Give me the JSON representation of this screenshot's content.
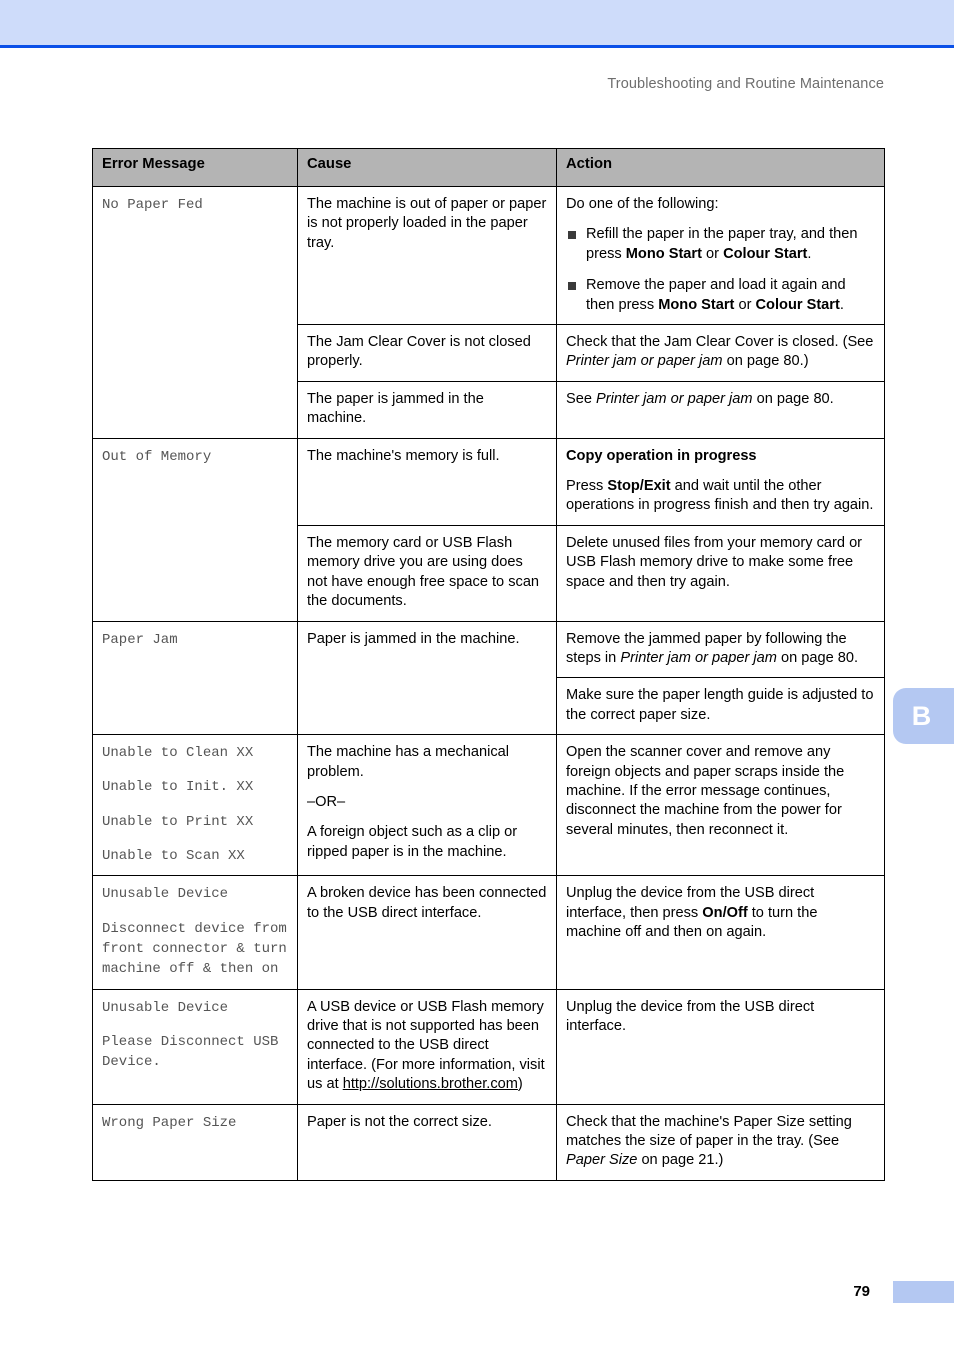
{
  "page": {
    "running_header": "Troubleshooting and Routine Maintenance",
    "page_number": "79",
    "chapter_tab_letter": "B",
    "accent_band_color": "#cedcfa",
    "accent_rule_color": "#0a50e8",
    "tab_color": "#b4c8f2",
    "header_row_color": "#b4b4b4"
  },
  "table": {
    "columns": [
      "Error Message",
      "Cause",
      "Action"
    ],
    "rows": [
      {
        "error_lines": [
          "No Paper Fed"
        ],
        "cells": [
          {
            "cause": {
              "paragraphs": [
                "The machine is out of paper or paper is not properly loaded in the paper tray."
              ]
            },
            "action": {
              "lead": "Do one of the following:",
              "bullets": [
                {
                  "parts": [
                    {
                      "t": "Refill the paper in the paper tray, and then press ",
                      "s": "normal"
                    },
                    {
                      "t": "Mono Start",
                      "s": "bold"
                    },
                    {
                      "t": " or ",
                      "s": "normal"
                    },
                    {
                      "t": "Colour Start",
                      "s": "bold"
                    },
                    {
                      "t": ".",
                      "s": "normal"
                    }
                  ]
                },
                {
                  "parts": [
                    {
                      "t": "Remove the paper and load it again and then press ",
                      "s": "normal"
                    },
                    {
                      "t": "Mono Start",
                      "s": "bold"
                    },
                    {
                      "t": " or ",
                      "s": "normal"
                    },
                    {
                      "t": "Colour Start",
                      "s": "bold"
                    },
                    {
                      "t": ".",
                      "s": "normal"
                    }
                  ]
                }
              ]
            }
          },
          {
            "cause": {
              "paragraphs": [
                "The Jam Clear Cover is not closed properly."
              ]
            },
            "action": {
              "paragraphs": [
                {
                  "parts": [
                    {
                      "t": "Check that the Jam Clear Cover is closed. (See ",
                      "s": "normal"
                    },
                    {
                      "t": "Printer jam or paper jam",
                      "s": "italic"
                    },
                    {
                      "t": " on page 80.)",
                      "s": "normal"
                    }
                  ]
                }
              ]
            }
          },
          {
            "cause": {
              "paragraphs": [
                "The paper is jammed in the machine."
              ]
            },
            "action": {
              "paragraphs": [
                {
                  "parts": [
                    {
                      "t": "See ",
                      "s": "normal"
                    },
                    {
                      "t": "Printer jam or paper jam",
                      "s": "italic"
                    },
                    {
                      "t": " on page 80.",
                      "s": "normal"
                    }
                  ]
                }
              ]
            }
          }
        ]
      },
      {
        "error_lines": [
          "Out of Memory"
        ],
        "cells": [
          {
            "cause": {
              "paragraphs": [
                "The machine's memory is full."
              ]
            },
            "action": {
              "heading": "Copy operation in progress",
              "paragraphs": [
                {
                  "parts": [
                    {
                      "t": "Press ",
                      "s": "normal"
                    },
                    {
                      "t": "Stop/Exit",
                      "s": "bold"
                    },
                    {
                      "t": " and wait until the other operations in progress finish and then try again.",
                      "s": "normal"
                    }
                  ]
                }
              ]
            }
          },
          {
            "cause": {
              "paragraphs": [
                "The memory card or USB Flash memory drive you are using does not have enough free space to scan the documents."
              ]
            },
            "action": {
              "paragraphs": [
                {
                  "parts": [
                    {
                      "t": "Delete unused files from your memory card or USB Flash memory drive to make some free space and then try again.",
                      "s": "normal"
                    }
                  ]
                }
              ]
            }
          }
        ]
      },
      {
        "error_lines": [
          "Paper Jam"
        ],
        "cells": [
          {
            "cause": {
              "paragraphs": [
                "Paper is jammed in the machine."
              ],
              "rowspan": 2
            },
            "action": {
              "paragraphs": [
                {
                  "parts": [
                    {
                      "t": "Remove the jammed paper by following the steps in ",
                      "s": "normal"
                    },
                    {
                      "t": "Printer jam or paper jam",
                      "s": "italic"
                    },
                    {
                      "t": " on page 80.",
                      "s": "normal"
                    }
                  ]
                }
              ]
            }
          },
          {
            "action": {
              "paragraphs": [
                {
                  "parts": [
                    {
                      "t": "Make sure the paper length guide is adjusted to the correct paper size.",
                      "s": "normal"
                    }
                  ]
                }
              ]
            }
          }
        ]
      },
      {
        "error_lines": [
          "Unable to Clean XX",
          "Unable to Init. XX",
          "Unable to Print XX",
          "Unable to Scan XX"
        ],
        "cells": [
          {
            "cause": {
              "paragraphs": [
                "The machine has a mechanical problem.",
                "–OR–",
                "A foreign object such as a clip or ripped paper is in the machine."
              ]
            },
            "action": {
              "paragraphs": [
                {
                  "parts": [
                    {
                      "t": "Open the scanner cover and remove any foreign objects and paper scraps inside the machine. If the error message continues, disconnect the machine from the power for several minutes, then reconnect it.",
                      "s": "normal"
                    }
                  ]
                }
              ]
            }
          }
        ]
      },
      {
        "error_lines": [
          "Unusable Device",
          "Disconnect device from front connector & turn machine off & then on"
        ],
        "cells": [
          {
            "cause": {
              "paragraphs": [
                "A broken device has been connected to the USB direct interface."
              ]
            },
            "action": {
              "paragraphs": [
                {
                  "parts": [
                    {
                      "t": "Unplug the device from the USB direct interface, then press ",
                      "s": "normal"
                    },
                    {
                      "t": "On/Off",
                      "s": "bold"
                    },
                    {
                      "t": " to turn the machine off and then on again.",
                      "s": "normal"
                    }
                  ]
                }
              ]
            }
          }
        ]
      },
      {
        "error_lines": [
          "Unusable Device",
          "Please Disconnect USB Device."
        ],
        "cells": [
          {
            "cause": {
              "parts": [
                {
                  "t": "A USB device or USB Flash memory drive that is not supported has been connected to the USB direct interface. (For more information, visit us at ",
                  "s": "normal"
                },
                {
                  "t": "http://solutions.brother.com",
                  "s": "url"
                },
                {
                  "t": ")",
                  "s": "normal"
                }
              ]
            },
            "action": {
              "paragraphs": [
                {
                  "parts": [
                    {
                      "t": "Unplug the device from the USB direct interface.",
                      "s": "normal"
                    }
                  ]
                }
              ]
            }
          }
        ]
      },
      {
        "error_lines": [
          "Wrong Paper Size"
        ],
        "cells": [
          {
            "cause": {
              "paragraphs": [
                "Paper is not the correct size."
              ]
            },
            "action": {
              "paragraphs": [
                {
                  "parts": [
                    {
                      "t": "Check that the machine's Paper Size setting matches the size of paper in the tray. (See ",
                      "s": "normal"
                    },
                    {
                      "t": "Paper Size",
                      "s": "italic"
                    },
                    {
                      "t": " on page 21.)",
                      "s": "normal"
                    }
                  ]
                }
              ]
            }
          }
        ]
      }
    ]
  }
}
